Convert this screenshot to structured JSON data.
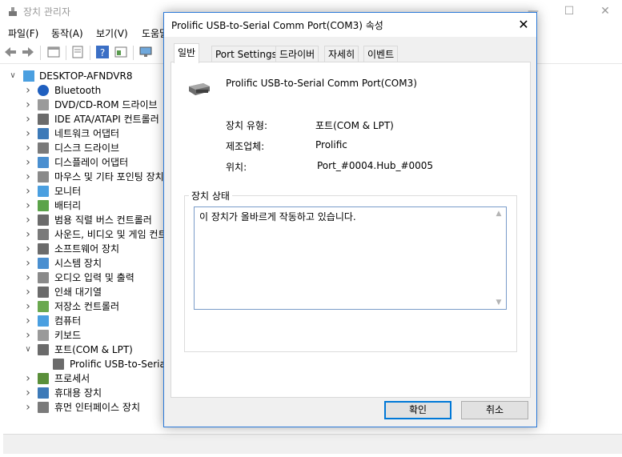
{
  "main_window": {
    "title": "장치 관리자",
    "controls": {
      "minimize": "—",
      "maximize": "☐",
      "close": "✕"
    },
    "menu": [
      "파일(F)",
      "동작(A)",
      "보기(V)",
      "도움말"
    ]
  },
  "tree": {
    "root": "DESKTOP-AFNDVR8",
    "items": [
      {
        "label": "Bluetooth",
        "icon": "bluetooth-icon",
        "expanded": false
      },
      {
        "label": "DVD/CD-ROM 드라이브",
        "icon": "disc-drive-icon",
        "expanded": false
      },
      {
        "label": "IDE ATA/ATAPI 컨트롤러",
        "icon": "ide-controller-icon",
        "expanded": false
      },
      {
        "label": "네트워크 어댑터",
        "icon": "network-adapter-icon",
        "expanded": false
      },
      {
        "label": "디스크 드라이브",
        "icon": "disk-drive-icon",
        "expanded": false
      },
      {
        "label": "디스플레이 어댑터",
        "icon": "display-adapter-icon",
        "expanded": false
      },
      {
        "label": "마우스 및 기타 포인팅 장치",
        "icon": "mouse-icon",
        "expanded": false
      },
      {
        "label": "모니터",
        "icon": "monitor-icon",
        "expanded": false
      },
      {
        "label": "배터리",
        "icon": "battery-icon",
        "expanded": false
      },
      {
        "label": "범용 직렬 버스 컨트롤러",
        "icon": "usb-icon",
        "expanded": false
      },
      {
        "label": "사운드, 비디오 및 게임 컨트롤러",
        "icon": "sound-icon",
        "expanded": false
      },
      {
        "label": "소프트웨어 장치",
        "icon": "software-device-icon",
        "expanded": false
      },
      {
        "label": "시스템 장치",
        "icon": "system-device-icon",
        "expanded": false
      },
      {
        "label": "오디오 입력 및 출력",
        "icon": "audio-icon",
        "expanded": false
      },
      {
        "label": "인쇄 대기열",
        "icon": "printer-icon",
        "expanded": false
      },
      {
        "label": "저장소 컨트롤러",
        "icon": "storage-controller-icon",
        "expanded": false
      },
      {
        "label": "컴퓨터",
        "icon": "computer-icon",
        "expanded": false
      },
      {
        "label": "키보드",
        "icon": "keyboard-icon",
        "expanded": false
      },
      {
        "label": "포트(COM & LPT)",
        "icon": "port-icon",
        "expanded": true
      },
      {
        "label": "Prolific USB-to-Serial",
        "icon": "port-icon",
        "child": true
      },
      {
        "label": "프로세서",
        "icon": "processor-icon",
        "expanded": false
      },
      {
        "label": "휴대용 장치",
        "icon": "portable-device-icon",
        "expanded": false
      },
      {
        "label": "휴먼 인터페이스 장치",
        "icon": "hid-icon",
        "expanded": false
      }
    ]
  },
  "dialog": {
    "title": "Prolific USB-to-Serial Comm Port(COM3) 속성",
    "close": "✕",
    "tabs": [
      "일반",
      "Port Settings",
      "드라이버",
      "자세히",
      "이벤트"
    ],
    "active_tab": 0,
    "device_name": "Prolific USB-to-Serial Comm Port(COM3)",
    "properties": {
      "type_label": "장치 유형:",
      "type_value": "포트(COM & LPT)",
      "manufacturer_label": "제조업체:",
      "manufacturer_value": "Prolific",
      "location_label": "위치:",
      "location_value": "Port_#0004.Hub_#0005"
    },
    "status_group_label": "장치 상태",
    "status_text": "이 장치가 올바르게 작동하고 있습니다.",
    "ok_label": "확인",
    "cancel_label": "취소"
  }
}
